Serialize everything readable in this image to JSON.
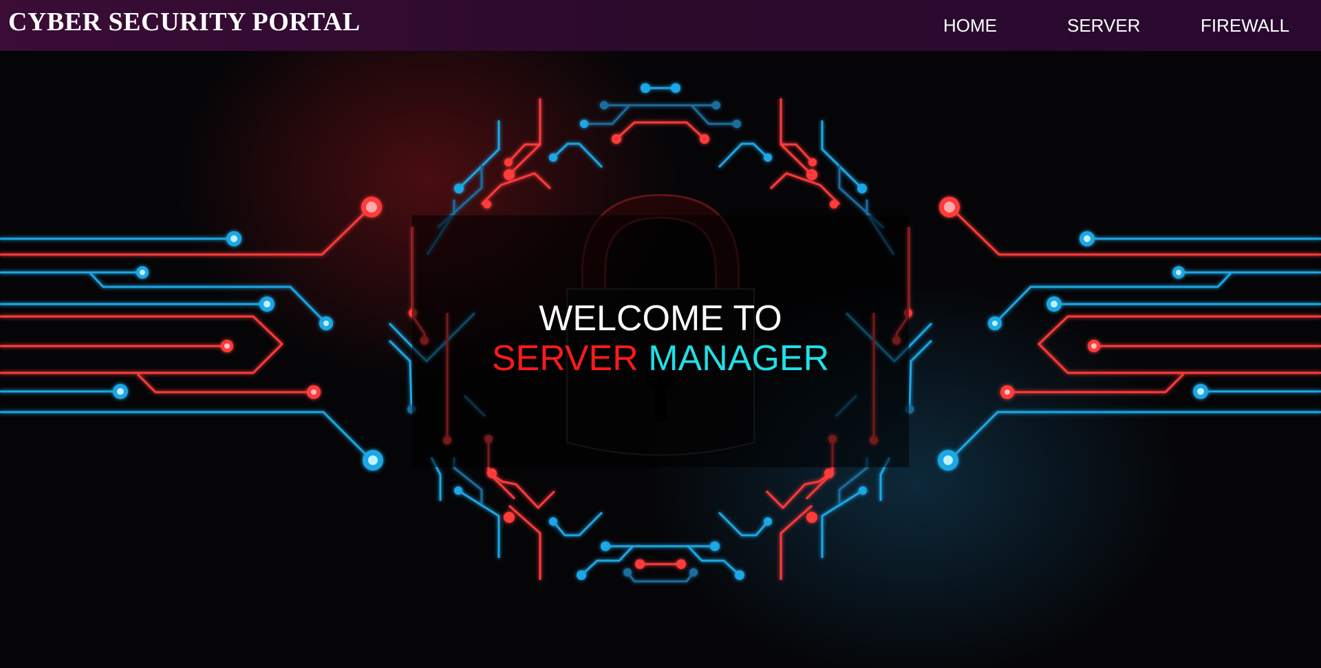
{
  "header": {
    "brand": "CYBER SECURITY PORTAL",
    "nav": [
      {
        "label": "HOME"
      },
      {
        "label": "SERVER"
      },
      {
        "label": "FIREWALL"
      }
    ]
  },
  "hero": {
    "line1": "WELCOME TO",
    "word_red": "SERVER",
    "word_cyan": "MANAGER",
    "accent_red": "#ff1a1a",
    "accent_cyan": "#1fe0e6"
  },
  "background": {
    "image": "circuit-board-padlock-illustration",
    "circuit_red": "#ff3b3b",
    "circuit_blue": "#1fa7e6",
    "navbar_color": "#3a0c36"
  }
}
